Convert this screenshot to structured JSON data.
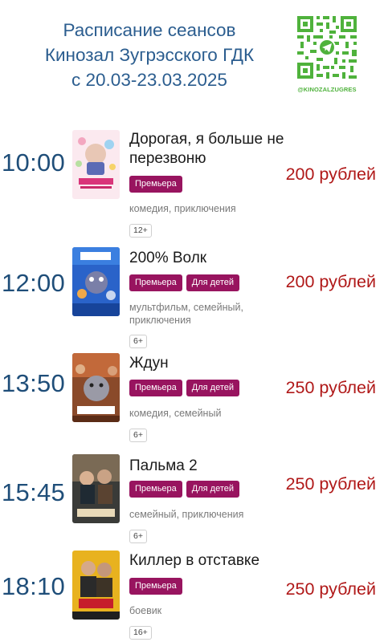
{
  "header": {
    "line1": "Расписание сеансов",
    "line2": "Кинозал Зугрэсского ГДК",
    "line3": "с 20.03-23.03.2025",
    "qr_handle": "@KINOZALZUGRES",
    "qr_color": "#4fb23c"
  },
  "colors": {
    "time": "#1f4e79",
    "price": "#b01818",
    "tag": "#98145f",
    "header": "#2b5d8f"
  },
  "sessions": [
    {
      "time": "10:00",
      "title": "Дорогая, я больше не перезвоню",
      "tags": [
        "Премьера"
      ],
      "genre": "комедия, приключения",
      "age": "12+",
      "price": "200 рублей"
    },
    {
      "time": "12:00",
      "title": "200% Волк",
      "tags": [
        "Премьера",
        "Для детей"
      ],
      "genre": "мультфильм, семейный, приключения",
      "age": "6+",
      "price": "200 рублей"
    },
    {
      "time": "13:50",
      "title": "Ждун",
      "tags": [
        "Премьера",
        "Для детей"
      ],
      "genre": "комедия, семейный",
      "age": "6+",
      "price": "250 рублей"
    },
    {
      "time": "15:45",
      "title": "Пальма 2",
      "tags": [
        "Премьера",
        "Для детей"
      ],
      "genre": "семейный, приключения",
      "age": "6+",
      "price": "250 рублей"
    },
    {
      "time": "18:10",
      "title": "Киллер в отставке",
      "tags": [
        "Премьера"
      ],
      "genre": "боевик",
      "age": "16+",
      "price": "250 рублей"
    }
  ]
}
